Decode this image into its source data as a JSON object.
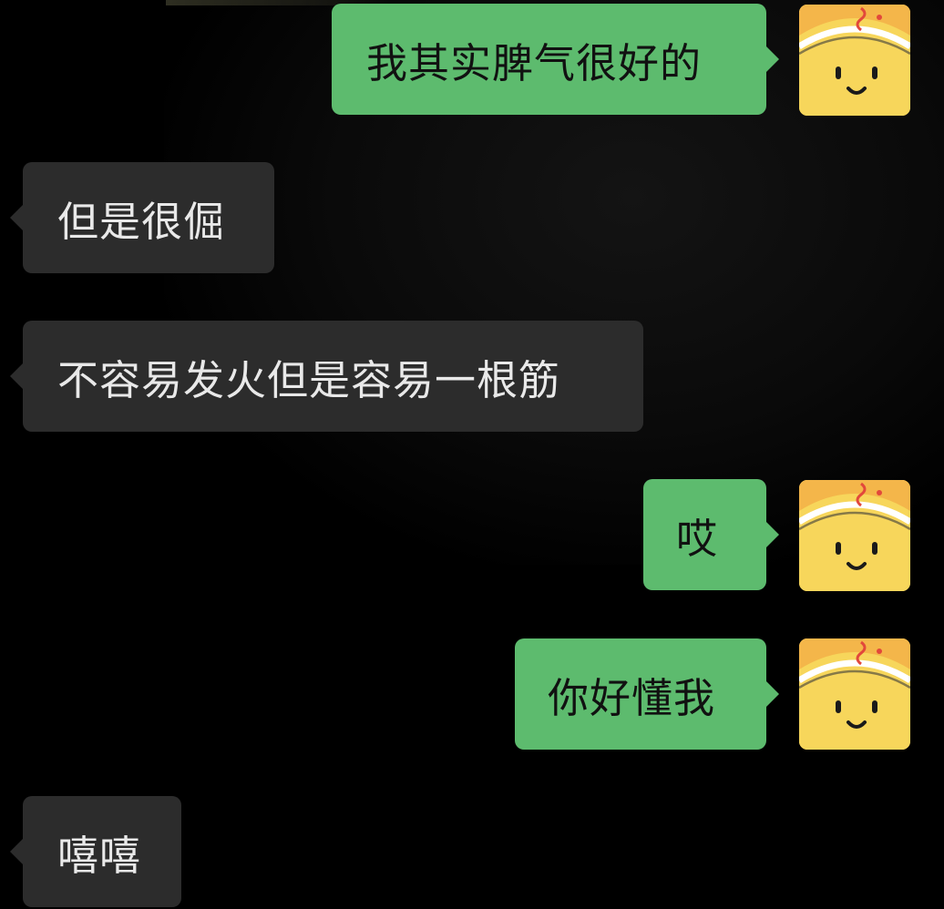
{
  "chat": {
    "messages": [
      {
        "side": "out",
        "text": "我其实脾气很好的"
      },
      {
        "side": "in",
        "text": "但是很倔"
      },
      {
        "side": "in",
        "text": "不容易发火但是容易一根筋"
      },
      {
        "side": "out",
        "text": "哎"
      },
      {
        "side": "out",
        "text": "你好懂我"
      },
      {
        "side": "in",
        "text": "嘻嘻"
      }
    ]
  },
  "colors": {
    "background": "#000000",
    "outgoing_bubble": "#5dbb6e",
    "incoming_bubble": "#2c2c2c",
    "incoming_text": "#e9e9e9",
    "outgoing_text": "#111111",
    "avatar_bg": "#f7d65b"
  },
  "icons": {
    "avatar": "yellow-smiley-avatar-icon"
  }
}
